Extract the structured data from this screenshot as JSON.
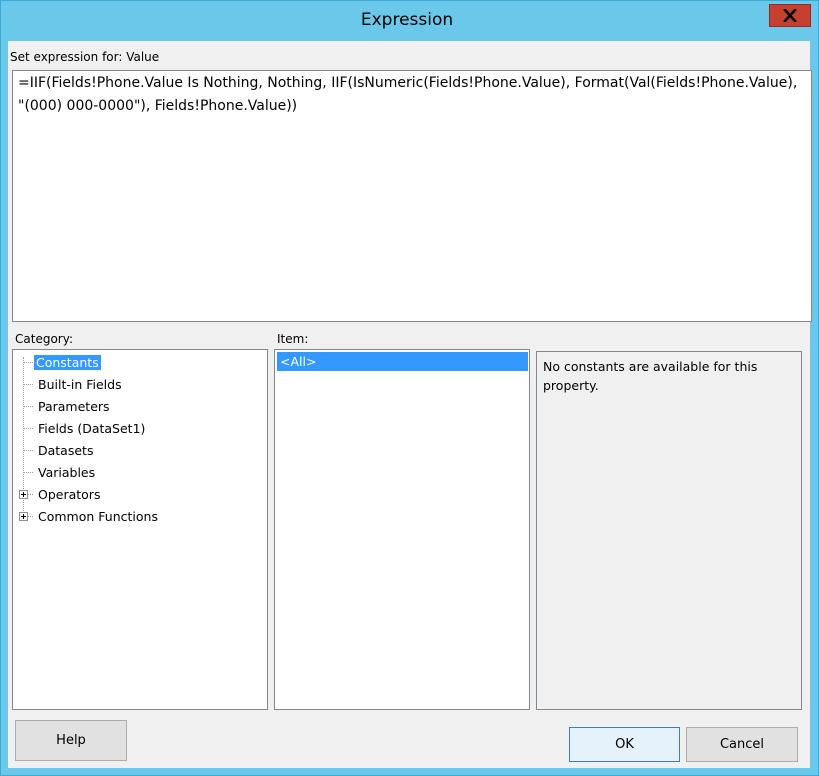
{
  "window": {
    "title": "Expression",
    "close_icon": "close-icon"
  },
  "expression": {
    "label": "Set expression for: Value",
    "value": "=IIF(Fields!Phone.Value Is Nothing, Nothing, IIF(IsNumeric(Fields!Phone.Value), Format(Val(Fields!Phone.Value), \"(000) 000-0000\"), Fields!Phone.Value))"
  },
  "category": {
    "label": "Category:",
    "items": [
      {
        "label": "Constants",
        "selected": true,
        "expandable": false
      },
      {
        "label": "Built-in Fields",
        "selected": false,
        "expandable": false
      },
      {
        "label": "Parameters",
        "selected": false,
        "expandable": false
      },
      {
        "label": "Fields (DataSet1)",
        "selected": false,
        "expandable": false
      },
      {
        "label": "Datasets",
        "selected": false,
        "expandable": false
      },
      {
        "label": "Variables",
        "selected": false,
        "expandable": false
      },
      {
        "label": "Operators",
        "selected": false,
        "expandable": true
      },
      {
        "label": "Common Functions",
        "selected": false,
        "expandable": true
      }
    ]
  },
  "item": {
    "label": "Item:",
    "items": [
      "<All>"
    ]
  },
  "description": {
    "text": "No constants are available for this property."
  },
  "buttons": {
    "help": "Help",
    "ok": "OK",
    "cancel": "Cancel"
  }
}
